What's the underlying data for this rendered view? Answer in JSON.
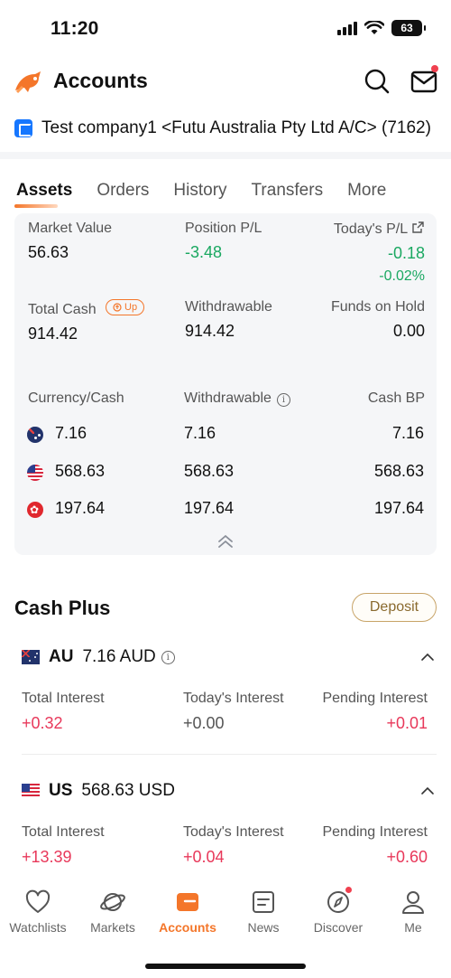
{
  "status_bar": {
    "time": "11:20",
    "battery": "63"
  },
  "header": {
    "title": "Accounts",
    "account_name": "Test company1 <Futu Australia Pty Ltd A/C> (7162)"
  },
  "tabs": [
    "Assets",
    "Orders",
    "History",
    "Transfers",
    "More"
  ],
  "assets": {
    "market_value": {
      "label": "Market Value",
      "value": "56.63"
    },
    "position_pl": {
      "label": "Position P/L",
      "value": "-3.48"
    },
    "todays_pl": {
      "label": "Today's P/L",
      "value": "-0.18",
      "percent": "-0.02%"
    },
    "total_cash": {
      "label": "Total Cash",
      "badge": "Up",
      "value": "914.42"
    },
    "withdrawable": {
      "label": "Withdrawable",
      "value": "914.42"
    },
    "funds_on_hold": {
      "label": "Funds on Hold",
      "value": "0.00"
    },
    "currency_table": {
      "headers": [
        "Currency/Cash",
        "Withdrawable",
        "Cash BP"
      ],
      "rows": [
        {
          "flag": "au-flag",
          "cash": "7.16",
          "withdrawable": "7.16",
          "cash_bp": "7.16"
        },
        {
          "flag": "us-flag",
          "cash": "568.63",
          "withdrawable": "568.63",
          "cash_bp": "568.63"
        },
        {
          "flag": "hk-flag",
          "cash": "197.64",
          "withdrawable": "197.64",
          "cash_bp": "197.64"
        }
      ]
    }
  },
  "cash_plus": {
    "title": "Cash Plus",
    "deposit_label": "Deposit",
    "accounts": [
      {
        "code": "AU",
        "amount": "7.16 AUD",
        "total_interest_label": "Total Interest",
        "total_interest": "+0.32",
        "todays_interest_label": "Today's Interest",
        "todays_interest": "+0.00",
        "pending_interest_label": "Pending Interest",
        "pending_interest": "+0.01"
      },
      {
        "code": "US",
        "amount": "568.63 USD",
        "total_interest_label": "Total Interest",
        "total_interest": "+13.39",
        "todays_interest_label": "Today's Interest",
        "todays_interest": "+0.04",
        "pending_interest_label": "Pending Interest",
        "pending_interest": "+0.60"
      }
    ]
  },
  "bottom_nav": [
    "Watchlists",
    "Markets",
    "Accounts",
    "News",
    "Discover",
    "Me"
  ],
  "colors": {
    "accent": "#f4762a",
    "positive": "#e8385a",
    "negative": "#1aa861",
    "brand_blue": "#1677ff"
  }
}
